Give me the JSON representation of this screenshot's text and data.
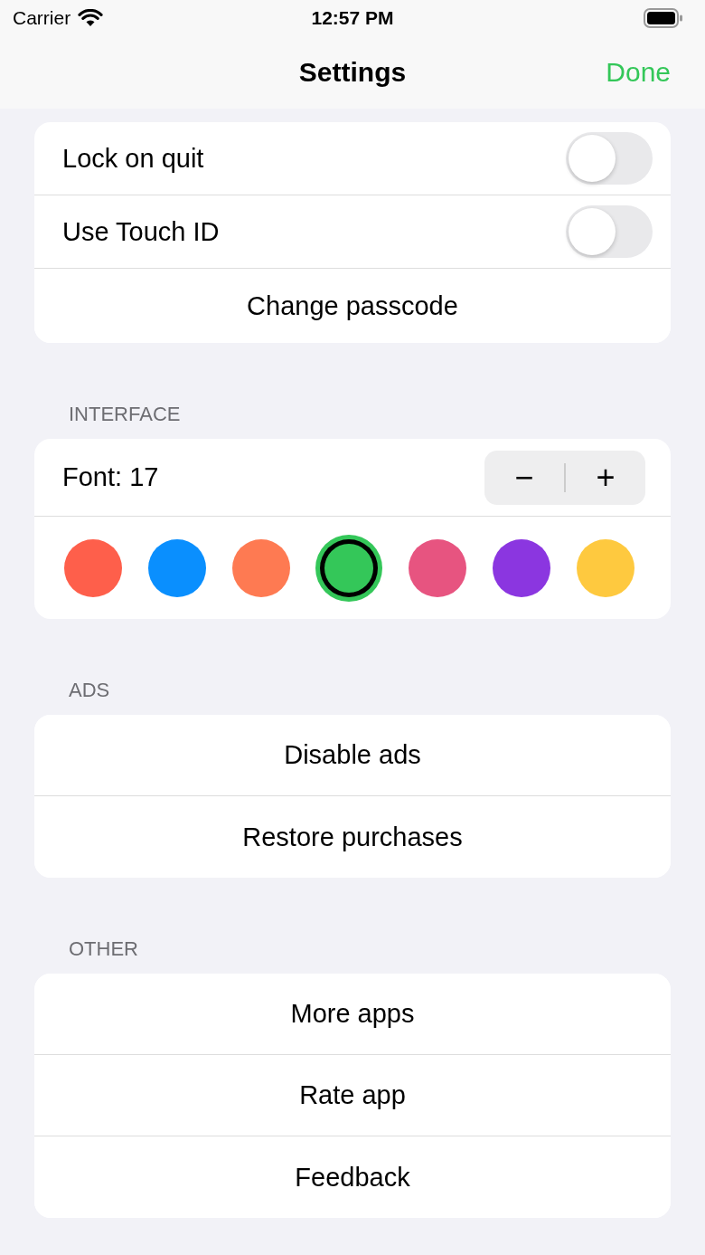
{
  "status_bar": {
    "carrier": "Carrier",
    "time": "12:57 PM"
  },
  "nav": {
    "title": "Settings",
    "done": "Done"
  },
  "security": {
    "toggles": [
      {
        "label": "Lock on quit",
        "on": false
      },
      {
        "label": "Use Touch ID",
        "on": false
      }
    ],
    "action": "Change passcode"
  },
  "interface": {
    "header": "INTERFACE",
    "font_label": "Font: 17",
    "decrease": "−",
    "increase": "+",
    "colors": [
      {
        "color": "#fe5f4b",
        "selected": false
      },
      {
        "color": "#0a8ffe",
        "selected": false
      },
      {
        "color": "#fe7a52",
        "selected": false
      },
      {
        "color": "#34c759",
        "selected": true
      },
      {
        "color": "#e75480",
        "selected": false
      },
      {
        "color": "#8b36e0",
        "selected": false
      },
      {
        "color": "#fec93f",
        "selected": false
      }
    ]
  },
  "ads": {
    "header": "ADS",
    "buttons": [
      "Disable ads",
      "Restore purchases"
    ]
  },
  "other": {
    "header": "OTHER",
    "buttons": [
      "More apps",
      "Rate app",
      "Feedback"
    ]
  }
}
